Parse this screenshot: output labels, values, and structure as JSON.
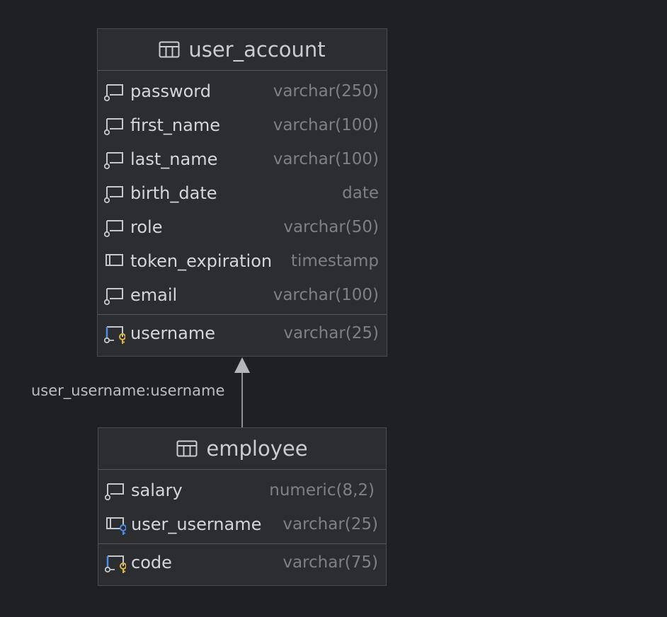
{
  "entities": {
    "user_account": {
      "name": "user_account",
      "columns": [
        {
          "name": "password",
          "type": "varchar(250)",
          "icon": "column-nullable-icon"
        },
        {
          "name": "first_name",
          "type": "varchar(100)",
          "icon": "column-nullable-icon"
        },
        {
          "name": "last_name",
          "type": "varchar(100)",
          "icon": "column-nullable-icon"
        },
        {
          "name": "birth_date",
          "type": "date",
          "icon": "column-nullable-icon"
        },
        {
          "name": "role",
          "type": "varchar(50)",
          "icon": "column-nullable-icon"
        },
        {
          "name": "token_expiration",
          "type": "timestamp",
          "icon": "column-icon"
        },
        {
          "name": "email",
          "type": "varchar(100)",
          "icon": "column-nullable-icon"
        }
      ],
      "primary_key": [
        {
          "name": "username",
          "type": "varchar(25)",
          "icon": "primary-key-icon"
        }
      ]
    },
    "employee": {
      "name": "employee",
      "columns": [
        {
          "name": "salary",
          "type": "numeric(8,2)",
          "icon": "column-nullable-icon"
        },
        {
          "name": "user_username",
          "type": "varchar(25)",
          "icon": "foreign-key-icon"
        }
      ],
      "primary_key": [
        {
          "name": "code",
          "type": "varchar(75)",
          "icon": "primary-key-icon"
        }
      ]
    }
  },
  "relationship": {
    "label": "user_username:username",
    "from": "employee",
    "to": "user_account",
    "line_color": "#8e9095"
  },
  "colors": {
    "background": "#1f2023",
    "entity_fill": "#2b2d31",
    "key_gold": "#e3b341",
    "key_blue": "#4d8ce8"
  }
}
